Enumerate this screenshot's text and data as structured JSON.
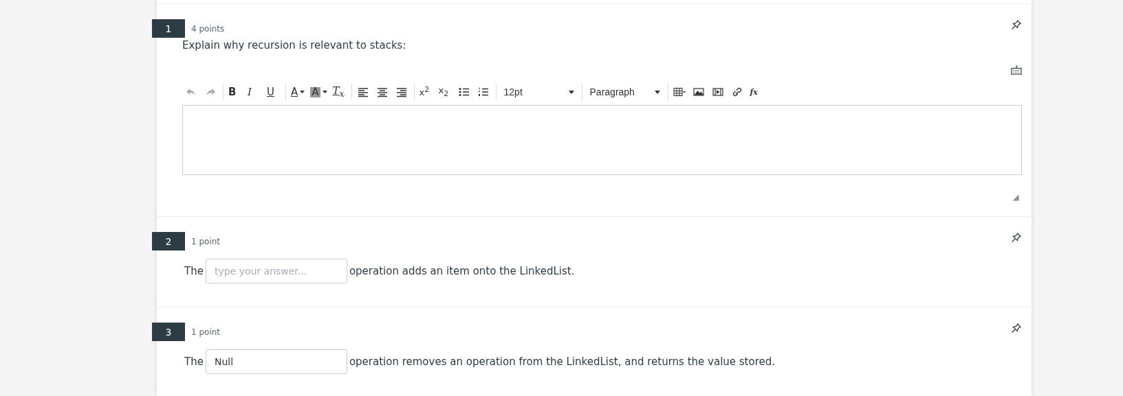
{
  "questions": [
    {
      "number": "1",
      "points": "4 points",
      "kind": "essay",
      "prompt": "Explain why recursion is relevant to stacks:",
      "editor": {
        "toolbar": [
          {
            "kind": "undo",
            "disabled": true
          },
          {
            "kind": "redo",
            "disabled": true
          },
          {
            "kind": "separator"
          },
          {
            "kind": "bold",
            "label": "B"
          },
          {
            "kind": "italic",
            "label": "I"
          },
          {
            "kind": "underline",
            "label": "U"
          },
          {
            "kind": "separator"
          },
          {
            "kind": "text-color",
            "label": "A"
          },
          {
            "kind": "highlight",
            "label": "A"
          },
          {
            "kind": "clear-format",
            "label": "T$_{x}$"
          },
          {
            "kind": "separator"
          },
          {
            "kind": "align-left"
          },
          {
            "kind": "align-center"
          },
          {
            "kind": "align-right"
          },
          {
            "kind": "separator"
          },
          {
            "kind": "superscript",
            "label": "x$^{2}$"
          },
          {
            "kind": "subscript",
            "label": "x$_{2}$"
          },
          {
            "kind": "bullet-list"
          },
          {
            "kind": "numbered-list"
          },
          {
            "kind": "separator"
          },
          {
            "kind": "dropdown",
            "label": "12pt"
          },
          {
            "kind": "separator"
          },
          {
            "kind": "dropdown",
            "label": "Paragraph"
          },
          {
            "kind": "separator"
          },
          {
            "kind": "table"
          },
          {
            "kind": "image"
          },
          {
            "kind": "media"
          },
          {
            "kind": "link"
          },
          {
            "kind": "formula",
            "label": "fx"
          }
        ]
      }
    },
    {
      "number": "2",
      "points": "1 point",
      "kind": "fill_blank",
      "before": "The",
      "placeholder": "type your answer...",
      "after": "operation adds an item onto the LinkedList."
    },
    {
      "number": "3",
      "points": "1 point",
      "kind": "fill_blank",
      "before": "The",
      "value": "Null",
      "after": "operation removes an operation from the LinkedList, and returns the value stored."
    }
  ]
}
